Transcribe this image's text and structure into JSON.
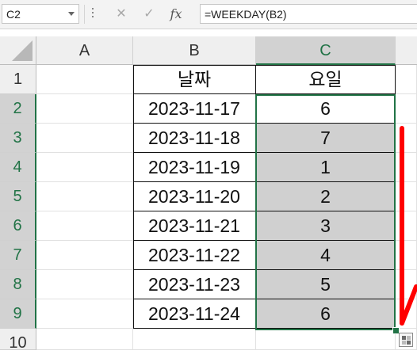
{
  "formula_bar": {
    "name_box": "C2",
    "cancel_icon": "✕",
    "enter_icon": "✓",
    "fx_icon": "fx",
    "formula": "=WEEKDAY(B2)"
  },
  "columns": [
    "A",
    "B",
    "C"
  ],
  "rows": [
    "1",
    "2",
    "3",
    "4",
    "5",
    "6",
    "7",
    "8",
    "9",
    "10"
  ],
  "table": {
    "header": [
      "날짜",
      "요일"
    ],
    "dates": [
      "2023-11-17",
      "2023-11-18",
      "2023-11-19",
      "2023-11-20",
      "2023-11-21",
      "2023-11-22",
      "2023-11-23",
      "2023-11-24"
    ],
    "weekdays": [
      "6",
      "7",
      "1",
      "2",
      "3",
      "4",
      "5",
      "6"
    ]
  },
  "selection": {
    "range": "C2:C9",
    "accent_color": "#217346",
    "fill_color": "#d0d0d0"
  },
  "annotation": {
    "arrow_color": "#ff0000",
    "arrow_icon": "red-down-arrow"
  },
  "quick_analysis_icon": "quick-analysis-icon"
}
